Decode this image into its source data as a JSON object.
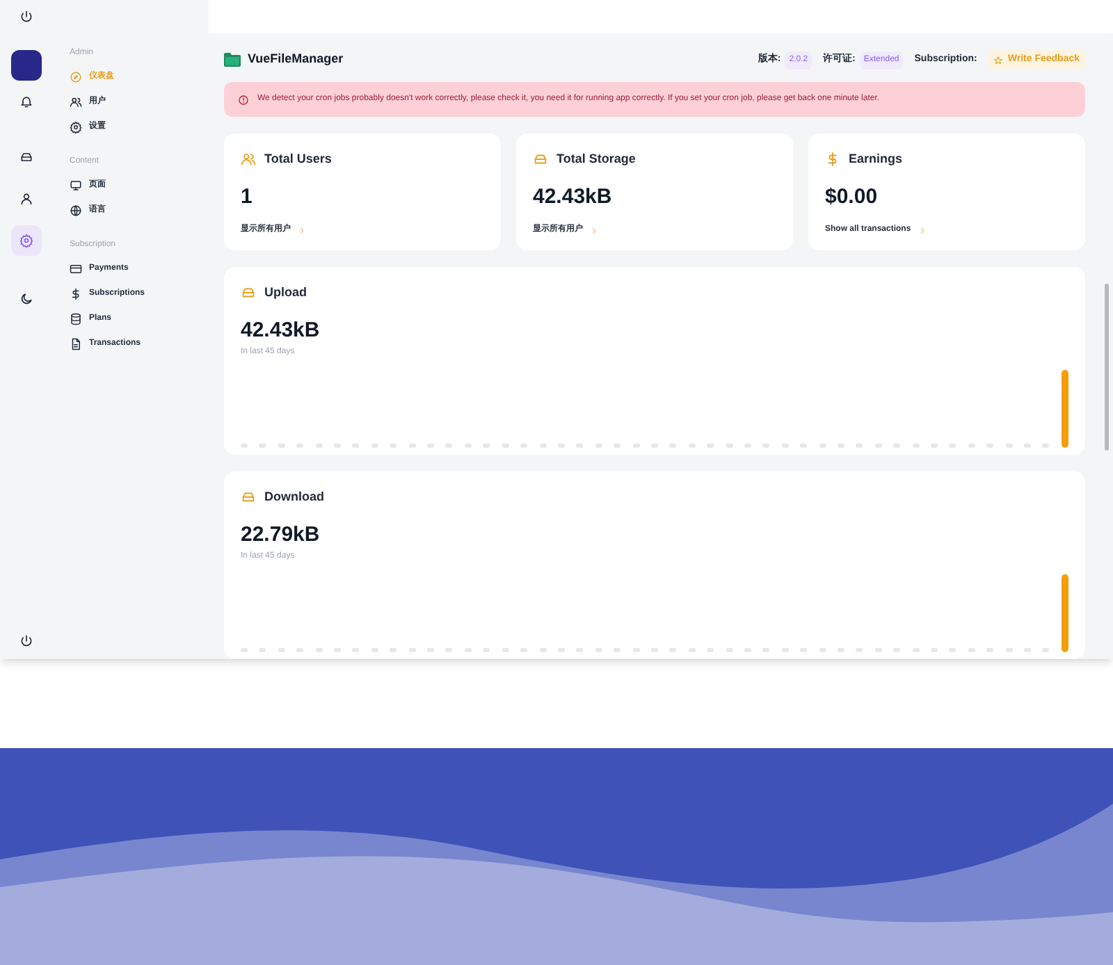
{
  "rail": [
    {
      "kind": "bell",
      "selected": false
    },
    {
      "kind": "drive",
      "selected": false
    },
    {
      "kind": "user",
      "selected": false
    },
    {
      "kind": "gear",
      "selected": true
    },
    {
      "kind": "moon",
      "selected": false
    }
  ],
  "nav": [
    {
      "title": "Admin",
      "items": [
        {
          "label": "仪表盘",
          "kind": "dashboard",
          "selected": true
        },
        {
          "label": "用户",
          "kind": "users",
          "selected": false
        },
        {
          "label": "设置",
          "kind": "gear",
          "selected": false
        }
      ]
    },
    {
      "title": "Content",
      "items": [
        {
          "label": "页面",
          "kind": "monitor",
          "selected": false
        },
        {
          "label": "语言",
          "kind": "globe",
          "selected": false
        }
      ]
    },
    {
      "title": "Subscription",
      "items": [
        {
          "label": "Payments",
          "kind": "card",
          "selected": false
        },
        {
          "label": "Subscriptions",
          "kind": "dollar",
          "selected": false
        },
        {
          "label": "Plans",
          "kind": "database",
          "selected": false
        },
        {
          "label": "Transactions",
          "kind": "file",
          "selected": false
        }
      ]
    }
  ],
  "header": {
    "app_name": "VueFileManager",
    "badges": [
      {
        "label": "版本:",
        "value": "2.0.2"
      },
      {
        "label": "许可证:",
        "value": "Extended"
      },
      {
        "label": "Subscription:"
      }
    ],
    "feedback_button": "Write Feedback"
  },
  "alert": "We detect your cron jobs probably doesn't work correctly, please check it, you need it for running app correctly. If you set your cron job, please get back one minute later.",
  "stats": [
    {
      "kind": "users",
      "title": "Total Users",
      "value": "1",
      "link": "显示所有用户"
    },
    {
      "kind": "drive",
      "title": "Total Storage",
      "value": "42.43kB",
      "link": "显示所有用户"
    },
    {
      "kind": "dollar",
      "title": "Earnings",
      "value": "$0.00",
      "link": "Show all transactions"
    }
  ],
  "traffic": [
    {
      "title": "Upload",
      "value": "42.43kB",
      "caption": "In last 45 days"
    },
    {
      "title": "Download",
      "value": "22.79kB",
      "caption": "In last 45 days"
    }
  ]
}
